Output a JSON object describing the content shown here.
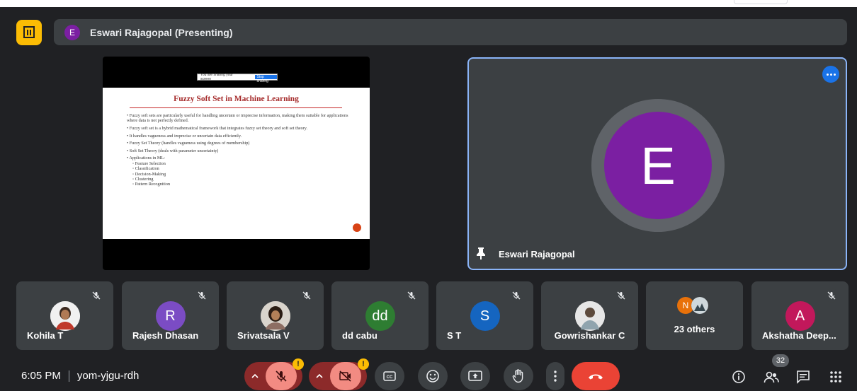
{
  "presentation_banner": {
    "avatar_letter": "E",
    "text": "Eswari Rajagopal (Presenting)",
    "icon": "presentation-icon"
  },
  "slide": {
    "share_bar_text": "You are sharing your screen",
    "share_bar_button": "Stop sharing",
    "title": "Fuzzy Soft Set in Machine Learning",
    "bullets": [
      "• Fuzzy soft sets are particularly useful for handling uncertain or imprecise information, making them suitable for applications where data is not perfectly defined.",
      "• Fuzzy soft set is a hybrid mathematical framework that integrates fuzzy set theory and soft set theory.",
      "• It handles vagueness and imprecise or uncertain data efficiently.",
      "• Fuzzy Set Theory (handles vagueness using degrees of membership)",
      "• Soft Set Theory (deals with parameter uncertainty)",
      "• Applications in ML:"
    ],
    "sub_bullets": [
      "◦ Feature Selection",
      "◦ Classification",
      "◦ Decision-Making",
      "◦ Clustering",
      "◦ Pattern Recognition"
    ]
  },
  "speaker": {
    "avatar_letter": "E",
    "name": "Eswari Rajagopal",
    "avatar_color": "#7b1fa2",
    "border_color": "#8ab4f8"
  },
  "participants": [
    {
      "name": "Kohila T",
      "avatar": "photo",
      "color": "#e8eaed"
    },
    {
      "name": "Rajesh Dhasan",
      "avatar": "R",
      "color": "#7b4cc4"
    },
    {
      "name": "Srivatsala V",
      "avatar": "photo",
      "color": "#cfcfcf"
    },
    {
      "name": "dd cabu",
      "avatar": "dd",
      "color": "#2e7d32"
    },
    {
      "name": "S T",
      "avatar": "S",
      "color": "#1565c0"
    },
    {
      "name": "Gowrishankar C",
      "avatar": "photo",
      "color": "#d8d8d8"
    },
    {
      "name": "23 others",
      "avatar": "N",
      "color": "#e8710a"
    },
    {
      "name": "Akshatha Deep...",
      "avatar": "A",
      "color": "#c2185b"
    }
  ],
  "bottom_bar": {
    "time": "6:05 PM",
    "meeting_code": "yom-yjgu-rdh",
    "people_count": "32",
    "warning_symbol": "!"
  },
  "colors": {
    "background": "#202124",
    "tile": "#3c4043",
    "end_call": "#ea4335",
    "muted_control": "#f28b82",
    "warning": "#fbbc04"
  }
}
